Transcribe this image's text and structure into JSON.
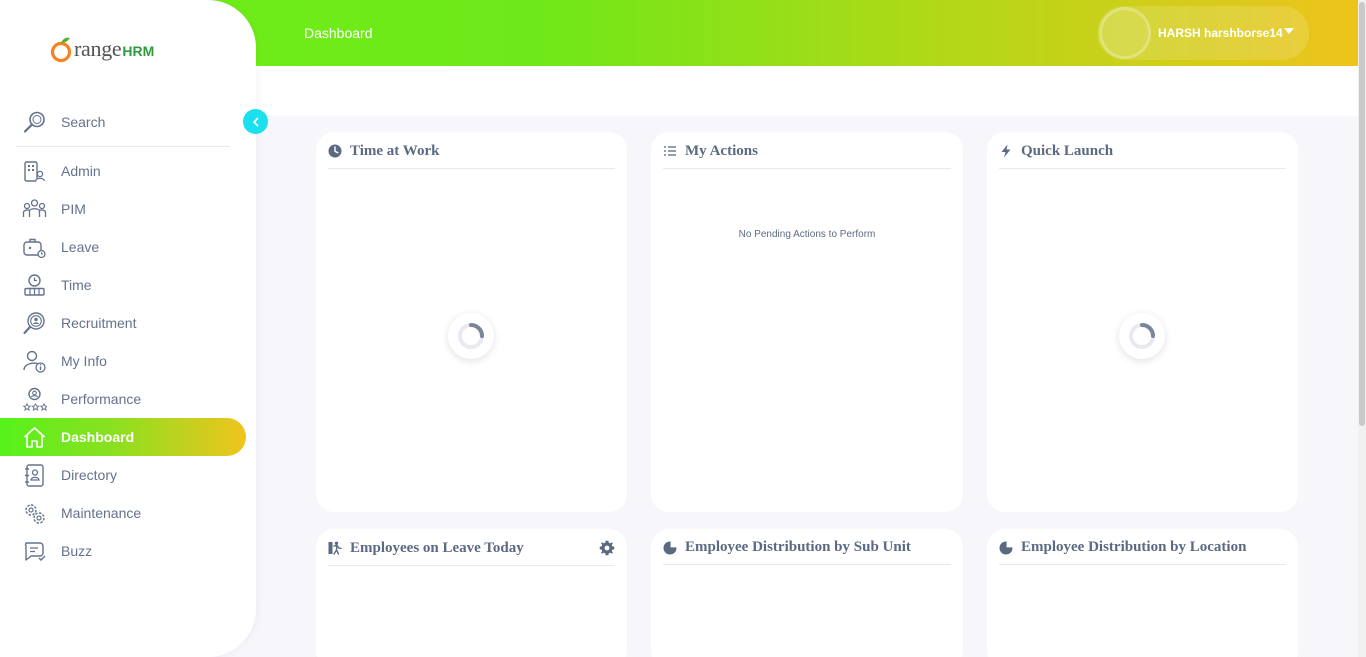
{
  "app": {
    "logo_main": "range",
    "logo_suffix": "HRM",
    "logo_full": "OrangeHRM"
  },
  "header": {
    "title": "Dashboard",
    "user_name": "HARSH harshborse14"
  },
  "colors": {
    "header_gradient_start": "#6ef019",
    "header_gradient_end": "#eec41c",
    "active_nav_start": "#56f21b",
    "active_nav_end": "#f0c41d",
    "collapse_button": "#1de0ee",
    "logo_orange": "#f6821f",
    "logo_green": "#2e9c3c"
  },
  "sidebar": {
    "search_label": "Search",
    "items": [
      {
        "label": "Admin",
        "icon": "admin-icon",
        "active": false
      },
      {
        "label": "PIM",
        "icon": "pim-icon",
        "active": false
      },
      {
        "label": "Leave",
        "icon": "leave-icon",
        "active": false
      },
      {
        "label": "Time",
        "icon": "time-icon",
        "active": false
      },
      {
        "label": "Recruitment",
        "icon": "recruitment-icon",
        "active": false
      },
      {
        "label": "My Info",
        "icon": "my-info-icon",
        "active": false
      },
      {
        "label": "Performance",
        "icon": "performance-icon",
        "active": false
      },
      {
        "label": "Dashboard",
        "icon": "dashboard-icon",
        "active": true
      },
      {
        "label": "Directory",
        "icon": "directory-icon",
        "active": false
      },
      {
        "label": "Maintenance",
        "icon": "maintenance-icon",
        "active": false
      },
      {
        "label": "Buzz",
        "icon": "buzz-icon",
        "active": false
      }
    ]
  },
  "cards": {
    "time_at_work": {
      "title": "Time at Work",
      "icon": "clock-icon",
      "state": "loading"
    },
    "my_actions": {
      "title": "My Actions",
      "icon": "list-icon",
      "message": "No Pending Actions to Perform"
    },
    "quick_launch": {
      "title": "Quick Launch",
      "icon": "lightning-icon",
      "state": "loading"
    },
    "employees_on_leave": {
      "title": "Employees on Leave Today",
      "icon": "leave-person-icon",
      "settings_icon": "gear-icon"
    },
    "distribution_sub_unit": {
      "title": "Employee Distribution by Sub Unit",
      "icon": "pie-chart-icon"
    },
    "distribution_location": {
      "title": "Employee Distribution by Location",
      "icon": "pie-chart-icon"
    }
  }
}
